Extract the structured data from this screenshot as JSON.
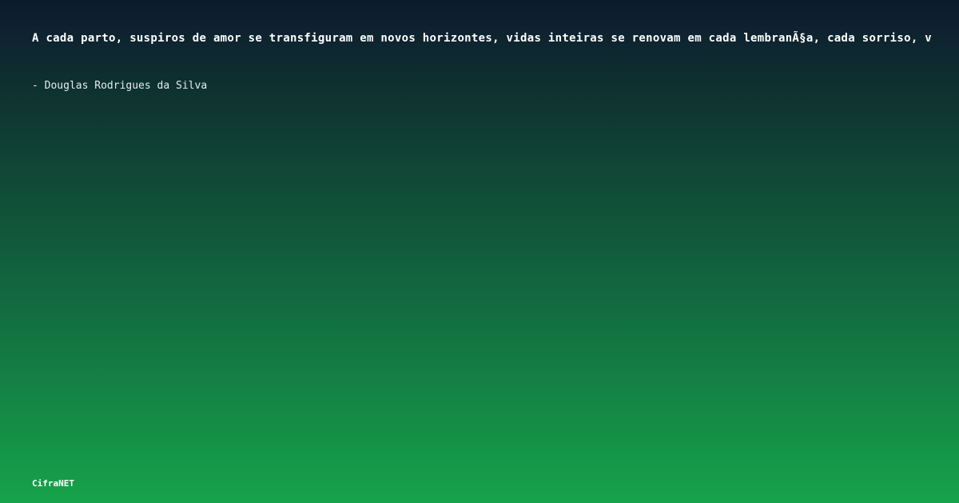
{
  "quote": {
    "text": "A cada parto, suspiros de amor se transfiguram em novos horizontes, vidas inteiras se renovam em cada lembranÃ§a, cada sorriso, v",
    "author": "- Douglas Rodrigues da Silva"
  },
  "brand": {
    "name": "CifraNET"
  },
  "colors": {
    "gradient_top": "#0d1a2e",
    "gradient_bottom": "#16a34a",
    "text": "#ffffff"
  }
}
